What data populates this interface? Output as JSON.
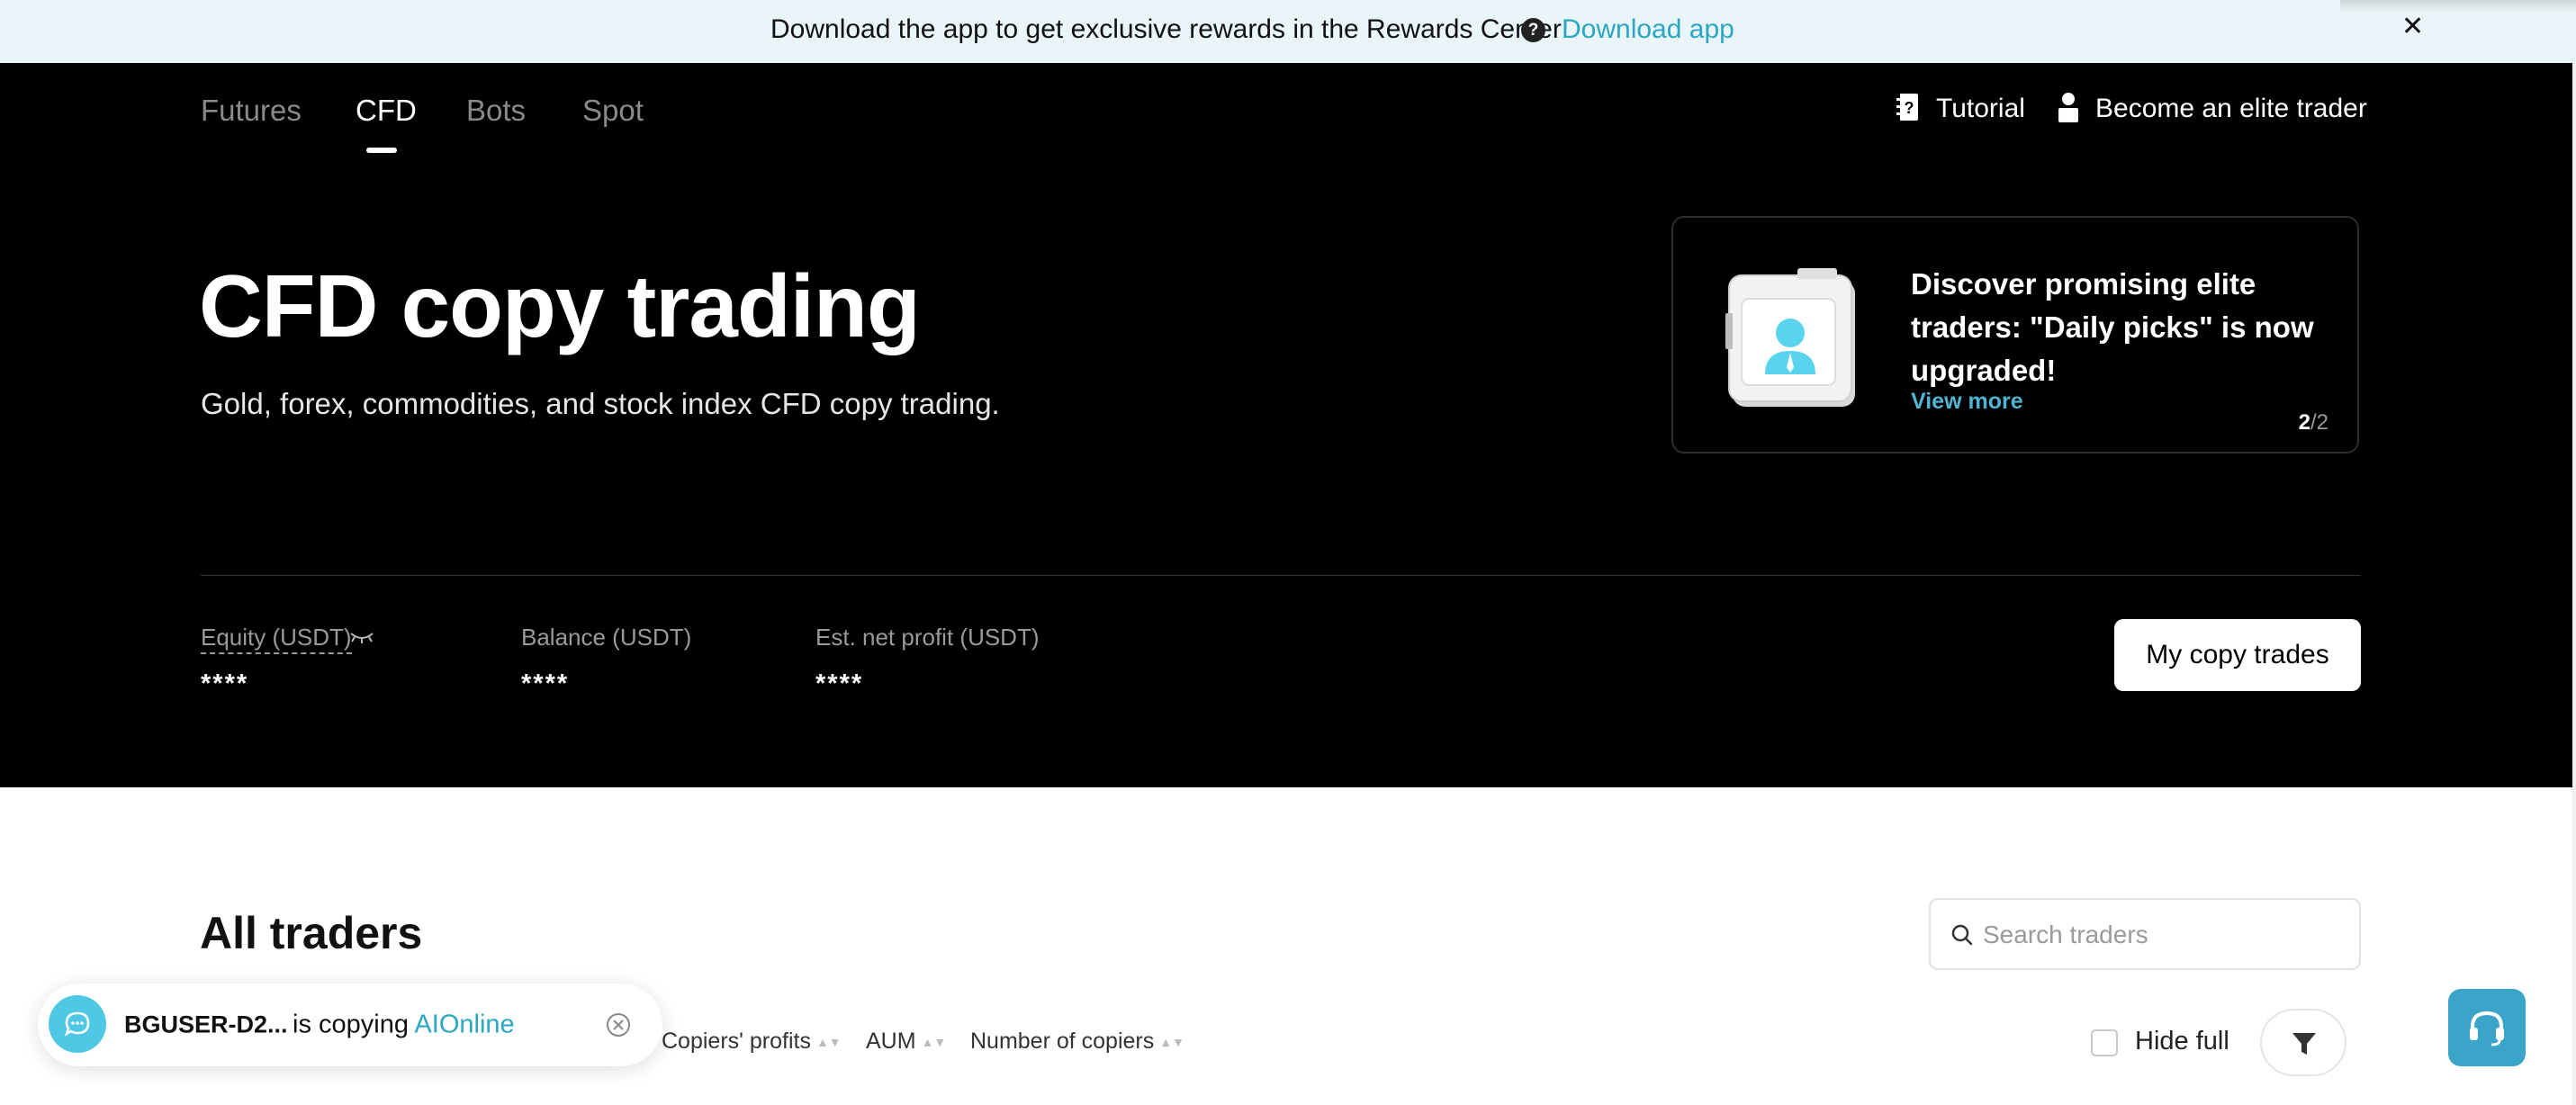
{
  "banner": {
    "message": "Download the app to get exclusive rewards in the Rewards Center!",
    "help_glyph": "?",
    "link": "Download app",
    "close_glyph": "✕"
  },
  "nav": {
    "tabs": [
      {
        "label": "Futures",
        "active": false
      },
      {
        "label": "CFD",
        "active": true
      },
      {
        "label": "Bots",
        "active": false
      },
      {
        "label": "Spot",
        "active": false
      }
    ],
    "tutorial": "Tutorial",
    "elite": "Become an elite trader"
  },
  "hero": {
    "title": "CFD copy trading",
    "subtitle": "Gold, forex, commodities, and stock index CFD copy trading."
  },
  "promo": {
    "title": "Discover promising elite traders: \"Daily picks\" is now upgraded!",
    "link": "View more",
    "page_current": "2",
    "page_total": "/2"
  },
  "stats": [
    {
      "label": "Equity (USDT)",
      "value": "****"
    },
    {
      "label": "Balance (USDT)",
      "value": "****"
    },
    {
      "label": "Est. net profit (USDT)",
      "value": "****"
    }
  ],
  "my_copy_trades": "My copy trades",
  "traders": {
    "title": "All traders",
    "search_placeholder": "Search traders",
    "sort_options": [
      "Copiers' profits",
      "AUM",
      "Number of copiers"
    ],
    "sort_arrow": "▲▼",
    "hide_full": "Hide full"
  },
  "toast": {
    "user": "BGUSER-D2...",
    "action": "is copying ",
    "target": "AIOnline"
  },
  "colors": {
    "accent": "#2aa7c4",
    "support": "#3aa4c9",
    "toast_icon": "#4fc8e6",
    "hero_bg": "#000000",
    "banner_bg": "#e9f5f8"
  }
}
